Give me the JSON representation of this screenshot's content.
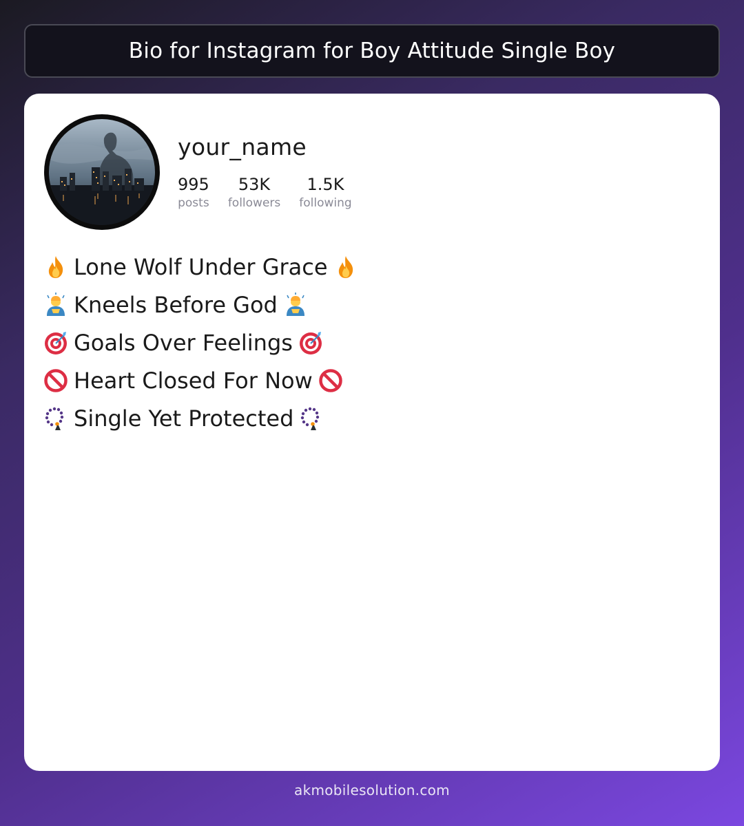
{
  "header": {
    "title": "Bio for Instagram for Boy Attitude Single Boy"
  },
  "profile": {
    "username": "your_name",
    "stats": [
      {
        "value": "995",
        "label": "posts"
      },
      {
        "value": "53K",
        "label": "followers"
      },
      {
        "value": "1.5K",
        "label": "following"
      }
    ]
  },
  "bio": {
    "lines": [
      {
        "text": "Lone Wolf Under Grace",
        "icon": "fire-icon"
      },
      {
        "text": "Kneels Before God",
        "icon": "person-bowing-icon"
      },
      {
        "text": "Goals Over Feelings",
        "icon": "target-icon"
      },
      {
        "text": "Heart Closed For Now",
        "icon": "prohibited-icon"
      },
      {
        "text": "Single Yet Protected",
        "icon": "prayer-beads-icon"
      }
    ]
  },
  "footer": {
    "text": "akmobilesolution.com"
  },
  "colors": {
    "card": "#ffffff",
    "title_bg": "#13121c",
    "gradient_end": "#7b47e0"
  }
}
